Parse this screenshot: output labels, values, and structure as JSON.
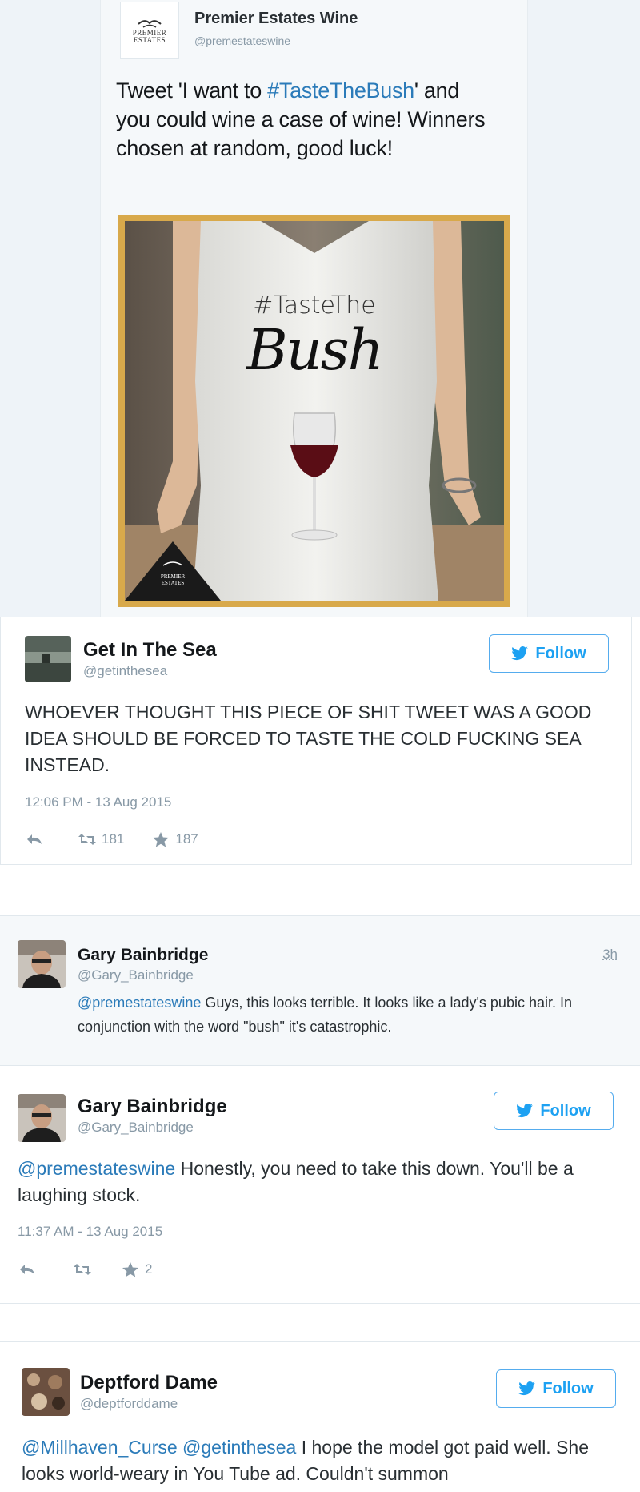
{
  "tweet1": {
    "name": "Premier Estates Wine",
    "handle": "@premestateswine",
    "logo_line1": "PREMIER",
    "logo_line2": "ESTATES",
    "text_before": "Tweet 'I want to ",
    "hashtag": "#TasteTheBush",
    "text_after": "' and you could wine a case of wine! Winners chosen at random, good luck!",
    "image": {
      "hashtag_text": "#TasteThe",
      "bush_text": "Bush",
      "corner_logo_line1": "PREMIER",
      "corner_logo_line2": "ESTATES"
    }
  },
  "tweet2": {
    "name": "Get In The Sea",
    "handle": "@getinthesea",
    "follow_label": "Follow",
    "text": "WHOEVER THOUGHT THIS PIECE OF SHIT TWEET WAS A GOOD IDEA SHOULD BE FORCED TO TASTE THE COLD FUCKING SEA INSTEAD.",
    "timestamp": "12:06 PM - 13 Aug 2015",
    "retweets": "181",
    "favorites": "187"
  },
  "tweet3": {
    "name": "Gary Bainbridge",
    "handle": "@Gary_Bainbridge",
    "time": "3h",
    "mention": "@premestateswine",
    "text": " Guys, this looks terrible. It looks like a lady's pubic hair. In conjunction with the word \"bush\" it's catastrophic."
  },
  "tweet4": {
    "name": "Gary Bainbridge",
    "handle": "@Gary_Bainbridge",
    "follow_label": "Follow",
    "mention": "@premestateswine",
    "text": " Honestly, you need to take this down. You'll be a laughing stock.",
    "timestamp": "11:37 AM - 13 Aug 2015",
    "retweets": "",
    "favorites": "2"
  },
  "tweet5": {
    "name": "Deptford Dame",
    "handle": "@deptforddame",
    "follow_label": "Follow",
    "mention1": "@Millhaven_Curse",
    "mention2": "@getinthesea",
    "text": " I hope the model got paid well. She looks world-weary in You Tube ad. Couldn't summon"
  },
  "colors": {
    "link": "#2b7bb9",
    "follow": "#1da1f2",
    "muted": "#8899a6",
    "frame": "#d8a94b"
  }
}
